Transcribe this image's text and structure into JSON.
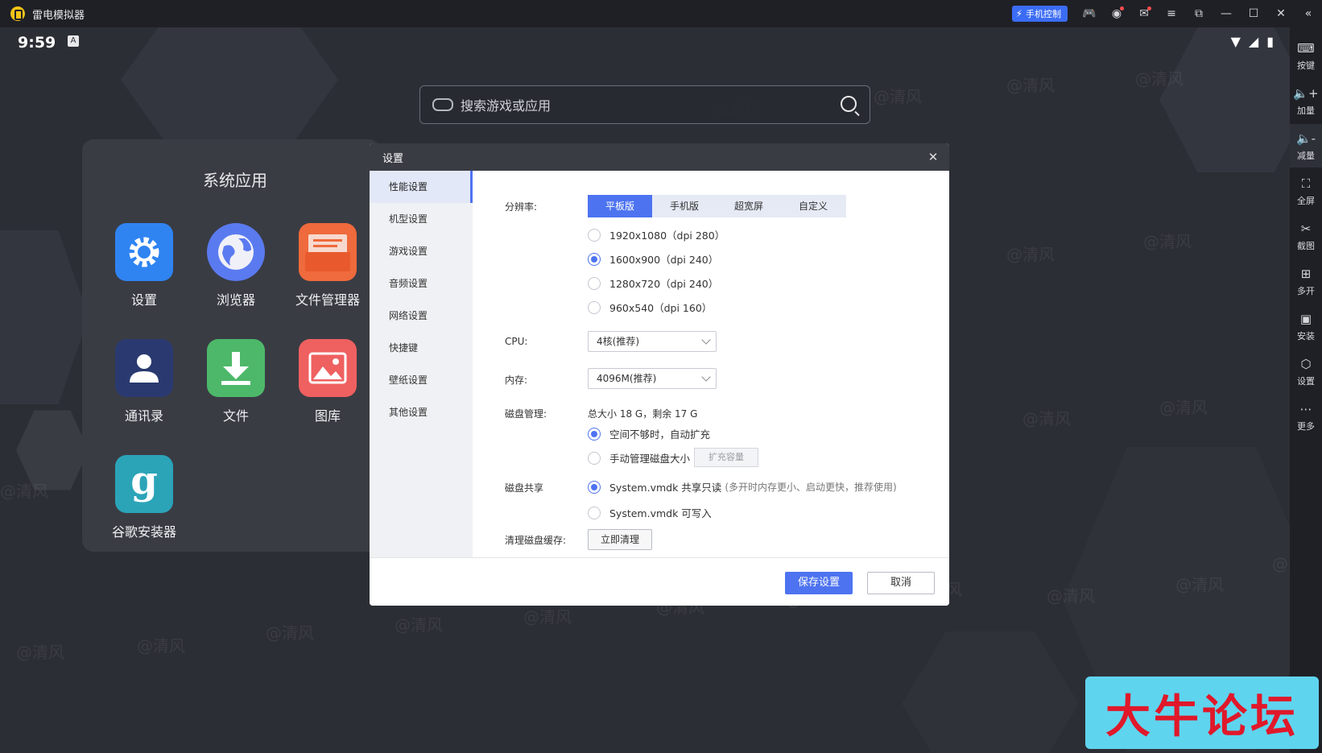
{
  "window": {
    "title": "雷电模拟器",
    "phone_control": "手机控制"
  },
  "status_bar": {
    "time": "9:59",
    "ime": "A"
  },
  "search": {
    "placeholder": "搜索游戏或应用"
  },
  "system_apps": {
    "title": "系统应用",
    "apps": [
      {
        "label": "设置",
        "color": "#2f84f2"
      },
      {
        "label": "浏览器",
        "color": "#5a7af0"
      },
      {
        "label": "文件管理器",
        "color": "#ef6a3c"
      },
      {
        "label": "通讯录",
        "color": "#2a3a70"
      },
      {
        "label": "文件",
        "color": "#4db86a"
      },
      {
        "label": "图库",
        "color": "#ef6060"
      },
      {
        "label": "谷歌安装器",
        "color": "#2ba4b8"
      }
    ]
  },
  "watermark": "@清风",
  "right_toolbar": [
    "按键",
    "加量",
    "减量",
    "全屏",
    "截图",
    "多开",
    "安装",
    "设置",
    "更多"
  ],
  "dialog": {
    "title": "设置",
    "nav": [
      "性能设置",
      "机型设置",
      "游戏设置",
      "音频设置",
      "网络设置",
      "快捷键",
      "壁纸设置",
      "其他设置"
    ],
    "active_nav": "性能设置",
    "resolution": {
      "label": "分辨率:",
      "tabs": [
        "平板版",
        "手机版",
        "超宽屏",
        "自定义"
      ],
      "active_tab": "平板版",
      "options": [
        "1920x1080（dpi 280）",
        "1600x900（dpi 240）",
        "1280x720（dpi 240）",
        "960x540（dpi 160）"
      ],
      "selected": "1600x900（dpi 240）"
    },
    "cpu": {
      "label": "CPU:",
      "value": "4核(推荐)"
    },
    "memory": {
      "label": "内存:",
      "value": "4096M(推荐)"
    },
    "disk": {
      "label": "磁盘管理:",
      "info": "总大小 18 G，剩余 17 G",
      "auto": "空间不够时，自动扩充",
      "manual": "手动管理磁盘大小",
      "expand_button": "扩充容量"
    },
    "disk_share": {
      "label": "磁盘共享",
      "readonly": "System.vmdk 共享只读",
      "readonly_hint": "(多开时内存更小、启动更快，推荐使用)",
      "writable": "System.vmdk 可写入"
    },
    "cache": {
      "label": "清理磁盘缓存:",
      "button": "立即清理"
    },
    "save": "保存设置",
    "cancel": "取消"
  },
  "corner_banner": "大牛论坛"
}
